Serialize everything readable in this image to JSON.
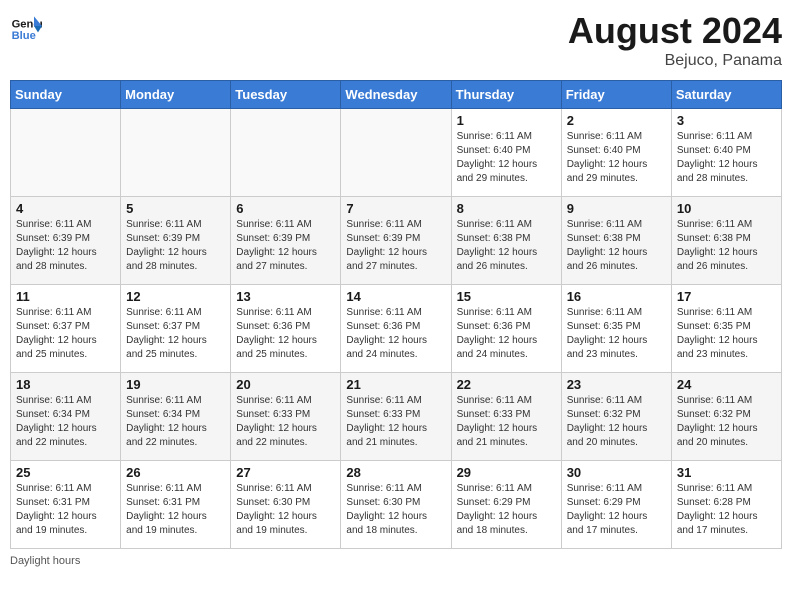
{
  "header": {
    "logo_line1": "General",
    "logo_line2": "Blue",
    "month_year": "August 2024",
    "location": "Bejuco, Panama"
  },
  "days_of_week": [
    "Sunday",
    "Monday",
    "Tuesday",
    "Wednesday",
    "Thursday",
    "Friday",
    "Saturday"
  ],
  "weeks": [
    [
      {
        "day": "",
        "empty": true
      },
      {
        "day": "",
        "empty": true
      },
      {
        "day": "",
        "empty": true
      },
      {
        "day": "",
        "empty": true
      },
      {
        "day": "1",
        "sunrise": "6:11 AM",
        "sunset": "6:40 PM",
        "daylight": "12 hours and 29 minutes."
      },
      {
        "day": "2",
        "sunrise": "6:11 AM",
        "sunset": "6:40 PM",
        "daylight": "12 hours and 29 minutes."
      },
      {
        "day": "3",
        "sunrise": "6:11 AM",
        "sunset": "6:40 PM",
        "daylight": "12 hours and 28 minutes."
      }
    ],
    [
      {
        "day": "4",
        "sunrise": "6:11 AM",
        "sunset": "6:39 PM",
        "daylight": "12 hours and 28 minutes."
      },
      {
        "day": "5",
        "sunrise": "6:11 AM",
        "sunset": "6:39 PM",
        "daylight": "12 hours and 28 minutes."
      },
      {
        "day": "6",
        "sunrise": "6:11 AM",
        "sunset": "6:39 PM",
        "daylight": "12 hours and 27 minutes."
      },
      {
        "day": "7",
        "sunrise": "6:11 AM",
        "sunset": "6:39 PM",
        "daylight": "12 hours and 27 minutes."
      },
      {
        "day": "8",
        "sunrise": "6:11 AM",
        "sunset": "6:38 PM",
        "daylight": "12 hours and 26 minutes."
      },
      {
        "day": "9",
        "sunrise": "6:11 AM",
        "sunset": "6:38 PM",
        "daylight": "12 hours and 26 minutes."
      },
      {
        "day": "10",
        "sunrise": "6:11 AM",
        "sunset": "6:38 PM",
        "daylight": "12 hours and 26 minutes."
      }
    ],
    [
      {
        "day": "11",
        "sunrise": "6:11 AM",
        "sunset": "6:37 PM",
        "daylight": "12 hours and 25 minutes."
      },
      {
        "day": "12",
        "sunrise": "6:11 AM",
        "sunset": "6:37 PM",
        "daylight": "12 hours and 25 minutes."
      },
      {
        "day": "13",
        "sunrise": "6:11 AM",
        "sunset": "6:36 PM",
        "daylight": "12 hours and 25 minutes."
      },
      {
        "day": "14",
        "sunrise": "6:11 AM",
        "sunset": "6:36 PM",
        "daylight": "12 hours and 24 minutes."
      },
      {
        "day": "15",
        "sunrise": "6:11 AM",
        "sunset": "6:36 PM",
        "daylight": "12 hours and 24 minutes."
      },
      {
        "day": "16",
        "sunrise": "6:11 AM",
        "sunset": "6:35 PM",
        "daylight": "12 hours and 23 minutes."
      },
      {
        "day": "17",
        "sunrise": "6:11 AM",
        "sunset": "6:35 PM",
        "daylight": "12 hours and 23 minutes."
      }
    ],
    [
      {
        "day": "18",
        "sunrise": "6:11 AM",
        "sunset": "6:34 PM",
        "daylight": "12 hours and 22 minutes."
      },
      {
        "day": "19",
        "sunrise": "6:11 AM",
        "sunset": "6:34 PM",
        "daylight": "12 hours and 22 minutes."
      },
      {
        "day": "20",
        "sunrise": "6:11 AM",
        "sunset": "6:33 PM",
        "daylight": "12 hours and 22 minutes."
      },
      {
        "day": "21",
        "sunrise": "6:11 AM",
        "sunset": "6:33 PM",
        "daylight": "12 hours and 21 minutes."
      },
      {
        "day": "22",
        "sunrise": "6:11 AM",
        "sunset": "6:33 PM",
        "daylight": "12 hours and 21 minutes."
      },
      {
        "day": "23",
        "sunrise": "6:11 AM",
        "sunset": "6:32 PM",
        "daylight": "12 hours and 20 minutes."
      },
      {
        "day": "24",
        "sunrise": "6:11 AM",
        "sunset": "6:32 PM",
        "daylight": "12 hours and 20 minutes."
      }
    ],
    [
      {
        "day": "25",
        "sunrise": "6:11 AM",
        "sunset": "6:31 PM",
        "daylight": "12 hours and 19 minutes."
      },
      {
        "day": "26",
        "sunrise": "6:11 AM",
        "sunset": "6:31 PM",
        "daylight": "12 hours and 19 minutes."
      },
      {
        "day": "27",
        "sunrise": "6:11 AM",
        "sunset": "6:30 PM",
        "daylight": "12 hours and 19 minutes."
      },
      {
        "day": "28",
        "sunrise": "6:11 AM",
        "sunset": "6:30 PM",
        "daylight": "12 hours and 18 minutes."
      },
      {
        "day": "29",
        "sunrise": "6:11 AM",
        "sunset": "6:29 PM",
        "daylight": "12 hours and 18 minutes."
      },
      {
        "day": "30",
        "sunrise": "6:11 AM",
        "sunset": "6:29 PM",
        "daylight": "12 hours and 17 minutes."
      },
      {
        "day": "31",
        "sunrise": "6:11 AM",
        "sunset": "6:28 PM",
        "daylight": "12 hours and 17 minutes."
      }
    ]
  ],
  "footer": {
    "daylight_label": "Daylight hours"
  }
}
